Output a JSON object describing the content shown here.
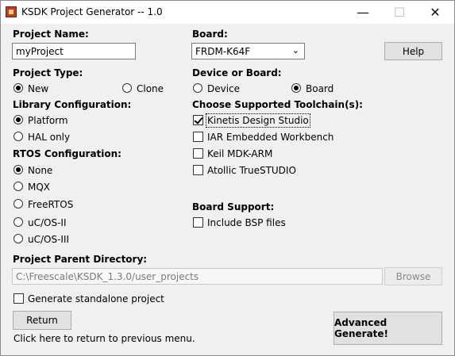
{
  "window": {
    "title": "KSDK Project Generator -- 1.0"
  },
  "project_name": {
    "label": "Project Name:",
    "value": "myProject"
  },
  "board": {
    "label": "Board:",
    "selected": "FRDM-K64F"
  },
  "help_label": "Help",
  "project_type": {
    "label": "Project Type:",
    "options": [
      "New",
      "Clone"
    ],
    "selected": "New"
  },
  "device_or_board": {
    "label": "Device or Board:",
    "options": [
      "Device",
      "Board"
    ],
    "selected": "Board"
  },
  "library": {
    "label": "Library Configuration:",
    "options": [
      "Platform",
      "HAL only"
    ],
    "selected": "Platform"
  },
  "toolchains": {
    "label": "Choose Supported Toolchain(s):",
    "items": [
      {
        "label": "Kinetis Design Studio",
        "checked": true
      },
      {
        "label": "IAR Embedded Workbench",
        "checked": false
      },
      {
        "label": "Keil MDK-ARM",
        "checked": false
      },
      {
        "label": "Atollic TrueSTUDIO",
        "checked": false
      }
    ]
  },
  "rtos": {
    "label": "RTOS Configuration:",
    "options": [
      "None",
      "MQX",
      "FreeRTOS",
      "uC/OS-II",
      "uC/OS-III"
    ],
    "selected": "None"
  },
  "board_support": {
    "label": "Board Support:",
    "bsp_label": "Include BSP files",
    "bsp_checked": false
  },
  "parent_dir": {
    "label": "Project Parent Directory:",
    "value": "C:\\Freescale\\KSDK_1.3.0/user_projects",
    "browse_label": "Browse"
  },
  "standalone": {
    "label": "Generate standalone project",
    "checked": false
  },
  "return_label": "Return",
  "return_hint": "Click here to return to previous menu.",
  "advanced_generate_label": "Advanced Generate!"
}
